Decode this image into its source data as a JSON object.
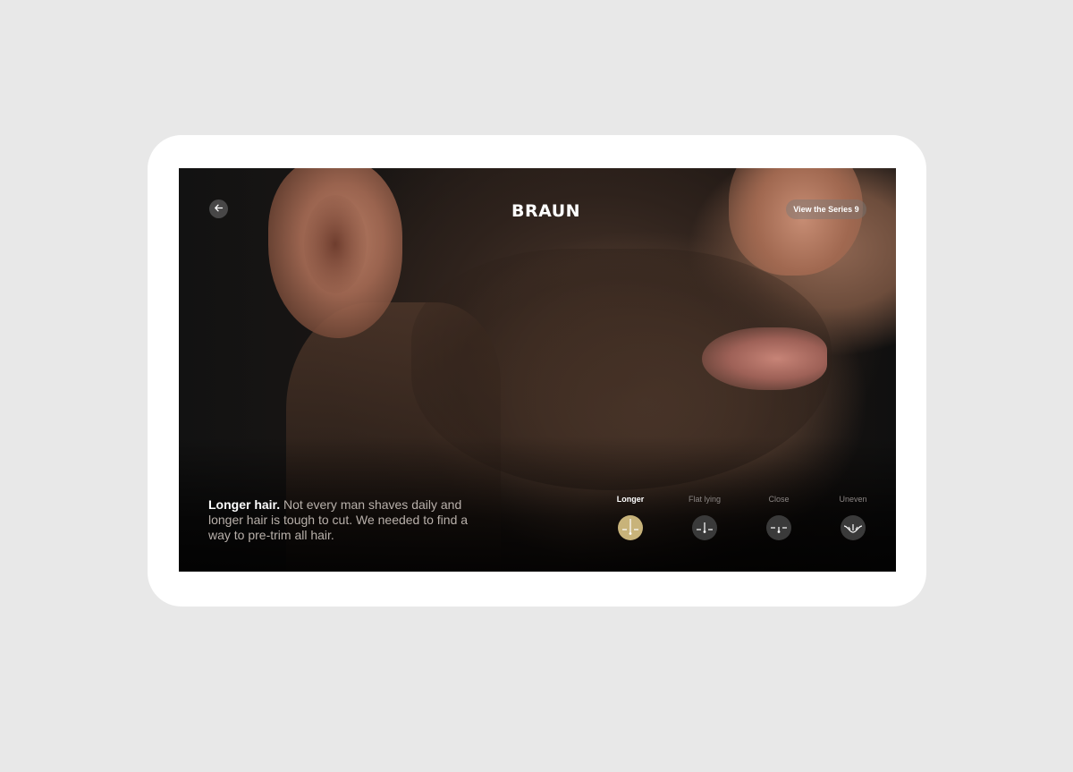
{
  "app": {
    "brand": "BRAUN",
    "back_icon": "arrow-left-icon",
    "cta_label": "View the Series 9"
  },
  "caption": {
    "lead": "Longer hair.",
    "body": "Not every man shaves daily and longer hair is tough to cut. We needed to find a way to pre-trim all hair."
  },
  "hair_types": [
    {
      "label": "Longer",
      "icon": "longer-hair-icon",
      "active": true
    },
    {
      "label": "Flat lying",
      "icon": "flat-lying-hair-icon",
      "active": false
    },
    {
      "label": "Close",
      "icon": "close-hair-icon",
      "active": false
    },
    {
      "label": "Uneven",
      "icon": "uneven-hair-icon",
      "active": false
    }
  ],
  "colors": {
    "accent": "#c8b37a",
    "background": "#e8e8e8",
    "device": "#ffffff"
  }
}
